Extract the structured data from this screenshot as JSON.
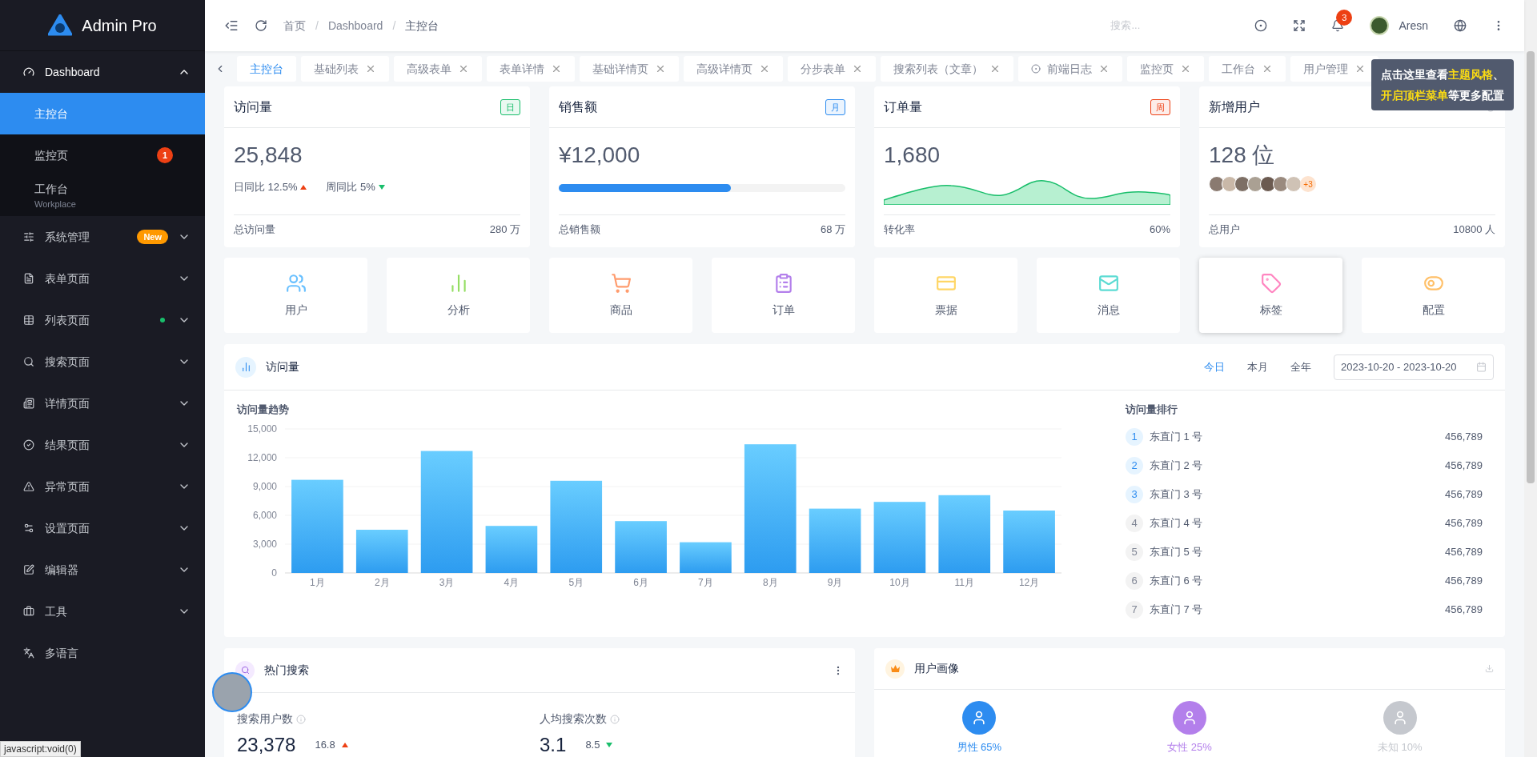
{
  "sidebar": {
    "logo": "Admin Pro",
    "items": [
      {
        "label": "Dashboard",
        "expanded": true,
        "children": [
          {
            "label": "主控台",
            "selected": true
          },
          {
            "label": "监控页",
            "selected": false,
            "badge": "1"
          },
          {
            "label": "工作台",
            "selected": false,
            "subtitle": "Workplace"
          }
        ]
      },
      {
        "label": "系统管理",
        "expanded": false,
        "tag": "New"
      },
      {
        "label": "表单页面",
        "expanded": false
      },
      {
        "label": "列表页面",
        "expanded": false,
        "dot": true
      },
      {
        "label": "搜索页面",
        "expanded": false
      },
      {
        "label": "详情页面",
        "expanded": false
      },
      {
        "label": "结果页面",
        "expanded": false
      },
      {
        "label": "异常页面",
        "expanded": false
      },
      {
        "label": "设置页面",
        "expanded": false
      },
      {
        "label": "编辑器",
        "expanded": false
      },
      {
        "label": "工具",
        "expanded": false
      },
      {
        "label": "多语言"
      }
    ]
  },
  "header": {
    "breadcrumb": [
      "首页",
      "Dashboard",
      "主控台"
    ],
    "separator": "/",
    "search": {
      "placeholder": "搜索..."
    },
    "notifications": "3",
    "user": "Aresn"
  },
  "tabs": [
    {
      "label": "主控台",
      "selected": true,
      "closable": false
    },
    {
      "label": "基础列表",
      "selected": false,
      "closable": true
    },
    {
      "label": "高级表单",
      "selected": false,
      "closable": true
    },
    {
      "label": "表单详情",
      "selected": false,
      "closable": true
    },
    {
      "label": "基础详情页",
      "selected": false,
      "closable": true
    },
    {
      "label": "高级详情页",
      "selected": false,
      "closable": true
    },
    {
      "label": "分步表单",
      "selected": false,
      "closable": true
    },
    {
      "label": "搜索列表（文章）",
      "selected": false,
      "closable": true
    },
    {
      "label": "前端日志",
      "selected": false,
      "closable": true,
      "dot_icon": true
    },
    {
      "label": "监控页",
      "selected": false,
      "closable": true
    },
    {
      "label": "工作台",
      "selected": false,
      "closable": true
    },
    {
      "label": "用户管理",
      "selected": false,
      "closable": true
    }
  ],
  "tooltip": [
    "点击这里查看**主题风格**、",
    "**开启顶栏菜单**等更多配置"
  ],
  "stat_cards": [
    {
      "title": "访问量",
      "tag": "日",
      "color": "#19be6b",
      "value": "25,848",
      "kind": "trend",
      "trends": [
        {
          "label": "日同比 12.5%",
          "up": true
        },
        {
          "label": "周同比 5%",
          "up": false
        }
      ],
      "footer_label": "总访问量",
      "footer_value": "280 万"
    },
    {
      "title": "销售额",
      "tag": "月",
      "color": "#2d8cf0",
      "value": "¥12,000",
      "kind": "progress",
      "level": 0.6,
      "footer_label": "总销售额",
      "footer_value": "68 万"
    },
    {
      "title": "订单量",
      "tag": "周",
      "color": "#ed4014",
      "value": "1,680",
      "kind": "area",
      "footer_label": "转化率",
      "footer_value": "60%"
    },
    {
      "title": "新增用户",
      "value": "128 位",
      "kind": "avatars",
      "extra": "+3",
      "footer_label": "总用户",
      "footer_value": "10800 人"
    }
  ],
  "quick_links": [
    {
      "label": "用户",
      "color": "#69c0ff",
      "hovered": false
    },
    {
      "label": "分析",
      "color": "#95de64",
      "hovered": false
    },
    {
      "label": "商品",
      "color": "#ff9c6e",
      "hovered": false
    },
    {
      "label": "订单",
      "color": "#b37feb",
      "hovered": false
    },
    {
      "label": "票据",
      "color": "#ffd666",
      "hovered": false
    },
    {
      "label": "消息",
      "color": "#5cdbd3",
      "hovered": false
    },
    {
      "label": "标签",
      "color": "#ff85c0",
      "hovered": true
    },
    {
      "label": "配置",
      "color": "#ffc069",
      "hovered": false
    }
  ],
  "visits": {
    "title": "访问量",
    "ranges": [
      {
        "label": "今日",
        "selected": true
      },
      {
        "label": "本月",
        "selected": false
      },
      {
        "label": "全年",
        "selected": false
      }
    ],
    "date_range": "2023-10-20 - 2023-10-20",
    "chart_title": "访问量趋势",
    "chart_data": {
      "type": "bar",
      "grid": true,
      "categories": [
        "1月",
        "2月",
        "3月",
        "4月",
        "5月",
        "6月",
        "7月",
        "8月",
        "9月",
        "10月",
        "11月",
        "12月"
      ],
      "series": [
        {
          "color": "#2d9cf0",
          "values": [
            9700,
            4500,
            12700,
            4900,
            9600,
            5400,
            3200,
            13400,
            6700,
            7400,
            8100,
            6500
          ]
        }
      ],
      "ylim": [
        0,
        15000
      ],
      "yticks": [
        {
          "value": 0,
          "label": "0"
        },
        {
          "value": 3000,
          "label": "3,000"
        },
        {
          "value": 6000,
          "label": "6,000"
        },
        {
          "value": 9000,
          "label": "9,000"
        },
        {
          "value": 12000,
          "label": "12,000"
        },
        {
          "value": 15000,
          "label": "15,000"
        }
      ]
    },
    "ranking_title": "访问量排行",
    "ranking": [
      {
        "rank": "1",
        "name": "东直门 1 号",
        "value": "456,789",
        "highlighted": true
      },
      {
        "rank": "2",
        "name": "东直门 2 号",
        "value": "456,789",
        "highlighted": true
      },
      {
        "rank": "3",
        "name": "东直门 3 号",
        "value": "456,789",
        "highlighted": true
      },
      {
        "rank": "4",
        "name": "东直门 4 号",
        "value": "456,789",
        "highlighted": false
      },
      {
        "rank": "5",
        "name": "东直门 5 号",
        "value": "456,789",
        "highlighted": false
      },
      {
        "rank": "6",
        "name": "东直门 6 号",
        "value": "456,789",
        "highlighted": false
      },
      {
        "rank": "7",
        "name": "东直门 7 号",
        "value": "456,789",
        "highlighted": false
      }
    ]
  },
  "hot_search": {
    "title": "热门搜索",
    "stats": [
      {
        "label": "搜索用户数",
        "value": "23,378",
        "change": "16.8",
        "up": true
      },
      {
        "label": "人均搜索次数",
        "value": "3.1",
        "change": "8.5",
        "up": false
      }
    ]
  },
  "user_profile": {
    "title": "用户画像",
    "groups": [
      {
        "label": "男性 65%",
        "color": "#2d8cf0"
      },
      {
        "label": "女性 25%",
        "color": "#b37feb"
      },
      {
        "label": "未知 10%",
        "color": "#c5c8ce"
      }
    ]
  },
  "status_bar": "javascript:void(0)"
}
